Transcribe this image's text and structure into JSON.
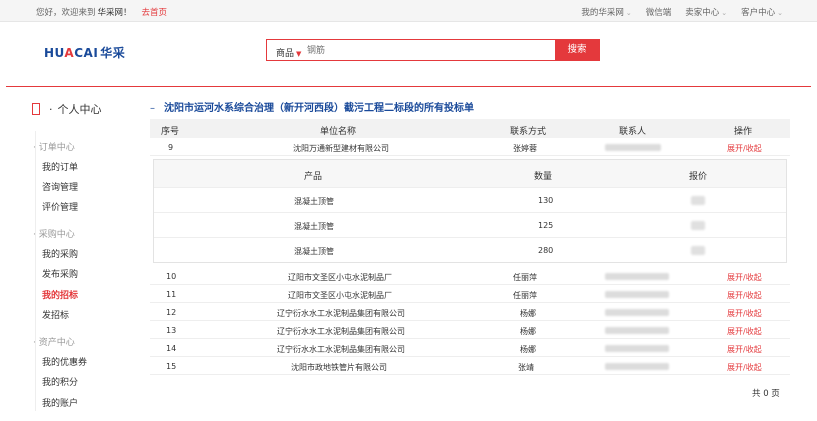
{
  "topbar": {
    "greeting": "您好，欢迎来到",
    "brand": "华采网！",
    "home_link": "去首页",
    "links": [
      "我的华采网",
      "微信端",
      "卖家中心",
      "客户中心"
    ]
  },
  "header": {
    "logo_part1": "HU",
    "logo_part2": "A",
    "logo_part3": "CAI",
    "logo_cn": "华采",
    "search_category": "商品",
    "search_placeholder": "钢筋",
    "search_button": "搜索"
  },
  "sidebar": {
    "title": "个人中心",
    "groups": [
      {
        "label": "订单中心",
        "items": [
          "我的订单",
          "咨询管理",
          "评价管理"
        ]
      },
      {
        "label": "采购中心",
        "items": [
          "我的采购",
          "发布采购",
          "我的招标",
          "发招标"
        ]
      },
      {
        "label": "资产中心",
        "items": [
          "我的优惠券",
          "我的积分",
          "我的账户"
        ]
      }
    ],
    "active_item": "我的招标"
  },
  "main": {
    "title": "沈阳市运河水系综合治理（新开河西段）截污工程二标段的所有投标单",
    "columns": [
      "序号",
      "单位名称",
      "联系方式",
      "联系人",
      "操作"
    ],
    "sub_columns": [
      "产品",
      "数量",
      "报价"
    ],
    "rows": [
      {
        "no": "9",
        "company": "沈阳万通新型建材有限公司",
        "contact": "张婷蓉",
        "op": "展开/收起"
      },
      {
        "no": "10",
        "company": "辽阳市文圣区小屯水泥制品厂",
        "contact": "任丽萍",
        "op": "展开/收起"
      },
      {
        "no": "11",
        "company": "辽阳市文圣区小屯水泥制品厂",
        "contact": "任丽萍",
        "op": "展开/收起"
      },
      {
        "no": "12",
        "company": "辽宁衍水水工水泥制品集团有限公司",
        "contact": "杨娜",
        "op": "展开/收起"
      },
      {
        "no": "13",
        "company": "辽宁衍水水工水泥制品集团有限公司",
        "contact": "杨娜",
        "op": "展开/收起"
      },
      {
        "no": "14",
        "company": "辽宁衍水水工水泥制品集团有限公司",
        "contact": "杨娜",
        "op": "展开/收起"
      },
      {
        "no": "15",
        "company": "沈阳市政地铁管片有限公司",
        "contact": "张靖",
        "op": "展开/收起"
      }
    ],
    "sub_rows": [
      {
        "product": "混凝土顶管",
        "qty": "130"
      },
      {
        "product": "混凝土顶管",
        "qty": "125"
      },
      {
        "product": "混凝土顶管",
        "qty": "280"
      }
    ],
    "pager": "共 0 页"
  },
  "colors": {
    "accent": "#e4393c",
    "link_blue": "#1a4a9a"
  }
}
